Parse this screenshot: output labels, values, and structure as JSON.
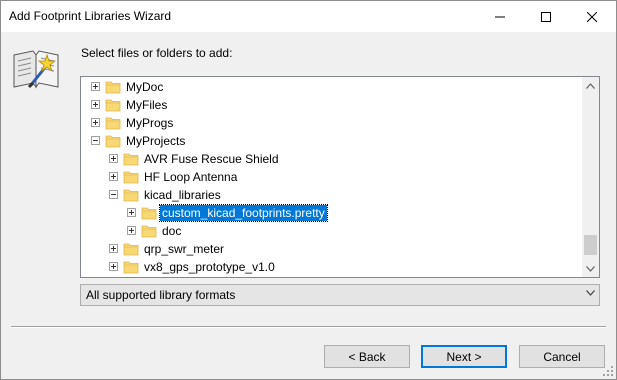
{
  "window": {
    "title": "Add Footprint Libraries Wizard",
    "controls": {
      "minimize": "minimize-icon",
      "maximize": "maximize-icon",
      "close": "close-icon"
    }
  },
  "prompt": "Select files or folders to add:",
  "tree": {
    "items": [
      {
        "label": "MyDoc",
        "expander": "plus"
      },
      {
        "label": "MyFiles",
        "expander": "plus"
      },
      {
        "label": "MyProgs",
        "expander": "plus"
      },
      {
        "label": "MyProjects",
        "expander": "minus"
      },
      {
        "label": "AVR Fuse Rescue Shield",
        "expander": "plus"
      },
      {
        "label": "HF Loop Antenna",
        "expander": "plus"
      },
      {
        "label": "kicad_libraries",
        "expander": "minus"
      },
      {
        "label": "custom_kicad_footprints.pretty",
        "expander": "plus",
        "selected": true
      },
      {
        "label": "doc",
        "expander": "plus"
      },
      {
        "label": "qrp_swr_meter",
        "expander": "plus"
      },
      {
        "label": "vx8_gps_prototype_v1.0",
        "expander": "plus"
      }
    ]
  },
  "filter": {
    "selected": "All supported library formats"
  },
  "buttons": {
    "back": "< Back",
    "next": "Next >",
    "cancel": "Cancel"
  },
  "colors": {
    "selection": "#0078d7",
    "folder": "#f8d775",
    "folder_dark": "#e0b64c"
  }
}
